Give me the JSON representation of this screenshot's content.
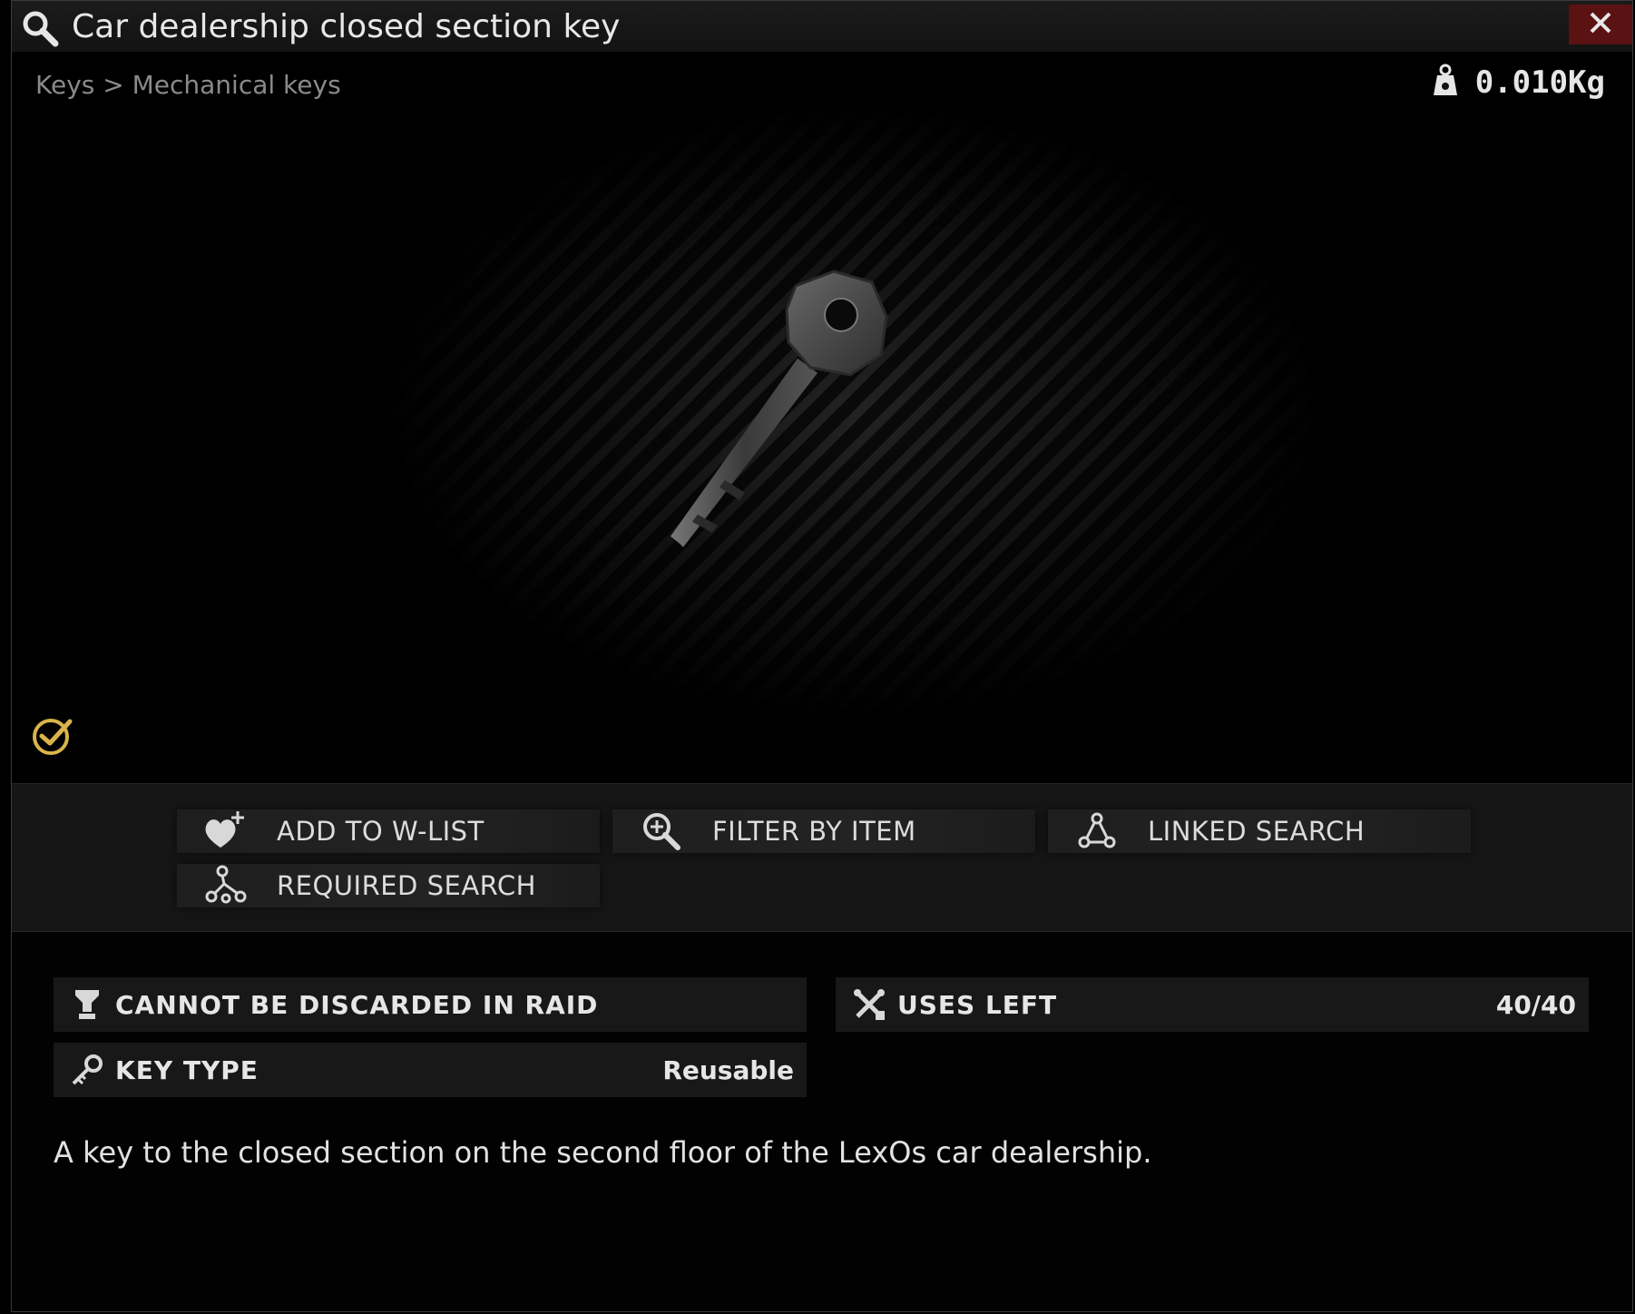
{
  "window": {
    "title": "Car dealership closed section key"
  },
  "breadcrumb": "Keys > Mechanical keys",
  "weight": "0.010Kg",
  "actions": [
    {
      "label": "ADD TO W-LIST"
    },
    {
      "label": "FILTER BY ITEM"
    },
    {
      "label": "LINKED SEARCH"
    },
    {
      "label": "REQUIRED SEARCH"
    }
  ],
  "stats": {
    "discard": {
      "name": "CANNOT BE DISCARDED IN RAID"
    },
    "uses_left": {
      "name": "USES LEFT",
      "value": "40/40"
    },
    "key_type": {
      "name": "KEY TYPE",
      "value": "Reusable"
    }
  },
  "description": "A key to the closed section on the second floor of the LexOs car dealership.",
  "colors": {
    "close_bg": "#5a1212",
    "found_in_raid": "#d8b44a"
  }
}
